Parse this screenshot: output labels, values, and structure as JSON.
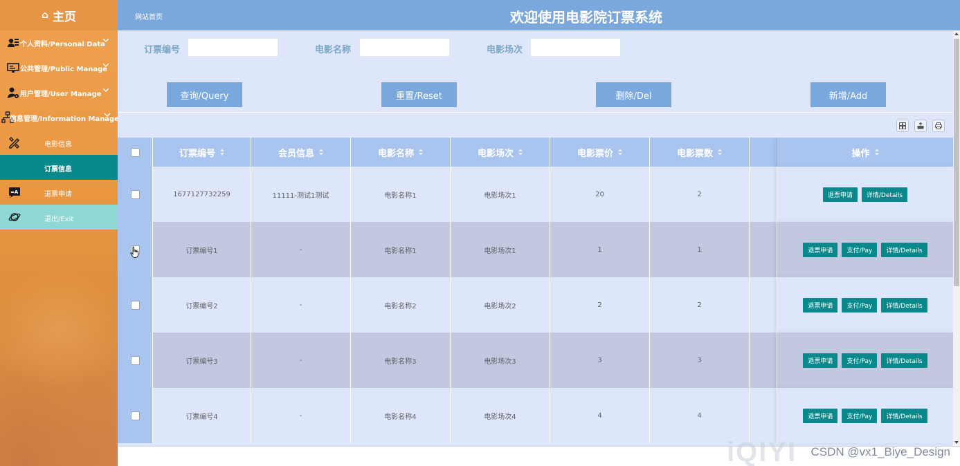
{
  "sidebar": {
    "brand": "主页",
    "items": [
      {
        "label": "个人资料/Personal Data",
        "icon": "user-card-icon",
        "chevron": true
      },
      {
        "label": "公共管理/Public Manage",
        "icon": "monitor-icon",
        "chevron": true
      },
      {
        "label": "用户管理/User Manage",
        "icon": "user-gear-icon",
        "chevron": true
      },
      {
        "label": "信息管理/Information Manage",
        "icon": "sitemap-icon",
        "chevron": true
      },
      {
        "label": "电影信息",
        "icon": "pencil-ruler-icon",
        "chevron": false
      },
      {
        "label": "订票信息",
        "icon": "",
        "chevron": false
      },
      {
        "label": "退票申请",
        "icon": "translate-icon",
        "chevron": false
      },
      {
        "label": "退出/Exit",
        "icon": "planet-icon",
        "chevron": false
      }
    ]
  },
  "header": {
    "site_link": "网站首页",
    "title": "欢迎使用电影院订票系统"
  },
  "search": {
    "fields": [
      {
        "label": "订票编号",
        "value": ""
      },
      {
        "label": "电影名称",
        "value": ""
      },
      {
        "label": "电影场次",
        "value": ""
      }
    ]
  },
  "actions": {
    "query": "查询/Query",
    "reset": "重置/Reset",
    "delete": "删除/Del",
    "add": "新增/Add"
  },
  "toolbar": {
    "icons": [
      "columns-icon",
      "export-icon",
      "print-icon"
    ]
  },
  "table": {
    "columns": [
      "订票编号",
      "会员信息",
      "电影名称",
      "电影场次",
      "电影票价",
      "电影票数"
    ],
    "op_header": "操作",
    "rows": [
      {
        "cells": [
          "1677127732259",
          "11111-测试1测试",
          "电影名称1",
          "电影场次1",
          "20",
          "2"
        ],
        "ops": [
          "退票申请",
          "详情/Details"
        ]
      },
      {
        "cells": [
          "订票编号1",
          "-",
          "电影名称1",
          "电影场次1",
          "1",
          "1"
        ],
        "ops": [
          "退票申请",
          "支付/Pay",
          "详情/Details"
        ]
      },
      {
        "cells": [
          "订票编号2",
          "-",
          "电影名称2",
          "电影场次2",
          "2",
          "2"
        ],
        "ops": [
          "退票申请",
          "支付/Pay",
          "详情/Details"
        ]
      },
      {
        "cells": [
          "订票编号3",
          "-",
          "电影名称3",
          "电影场次3",
          "3",
          "3"
        ],
        "ops": [
          "退票申请",
          "支付/Pay",
          "详情/Details"
        ]
      },
      {
        "cells": [
          "订票编号4",
          "-",
          "电影名称4",
          "电影场次4",
          "4",
          "4"
        ],
        "ops": [
          "退票申请",
          "支付/Pay",
          "详情/Details"
        ]
      }
    ]
  },
  "watermark": {
    "text": "CSDN @vx1_Biye_Design",
    "logo": "iQIYI"
  }
}
